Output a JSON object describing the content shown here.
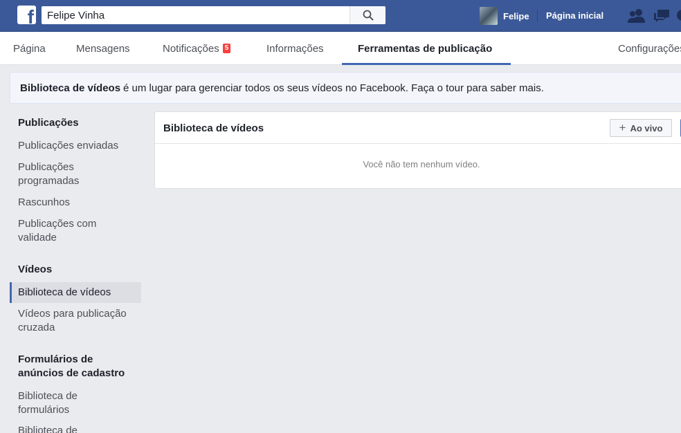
{
  "topbar": {
    "search_value": "Felipe Vinha",
    "user_name": "Felipe",
    "home_label": "Página inicial"
  },
  "nav": {
    "tabs": [
      {
        "label": "Página"
      },
      {
        "label": "Mensagens"
      },
      {
        "label": "Notificações",
        "badge": "5"
      },
      {
        "label": "Informações"
      },
      {
        "label": "Ferramentas de publicação",
        "active": true
      },
      {
        "label": "Configurações"
      }
    ]
  },
  "banner": {
    "bold": "Biblioteca de vídeos",
    "text": "é um lugar para gerenciar todos os seus vídeos no Facebook. Faça o tour para saber mais."
  },
  "sidebar": {
    "sections": [
      {
        "title": "Publicações",
        "items": [
          "Publicações enviadas",
          "Publicações programadas",
          "Rascunhos",
          "Publicações com validade"
        ]
      },
      {
        "title": "Vídeos",
        "items": [
          "Biblioteca de vídeos",
          "Vídeos para publicação cruzada"
        ]
      },
      {
        "title": "Formulários de anúncios de cadastro",
        "items": [
          "Biblioteca de formulários",
          "Biblioteca de"
        ]
      }
    ]
  },
  "card": {
    "title": "Biblioteca de vídeos",
    "live_button": "Ao vivo",
    "empty_message": "Você não tem nenhum vídeo."
  },
  "colors": {
    "brand": "#3b5998",
    "accent": "#4267b2",
    "badge": "#fa3e3e"
  }
}
